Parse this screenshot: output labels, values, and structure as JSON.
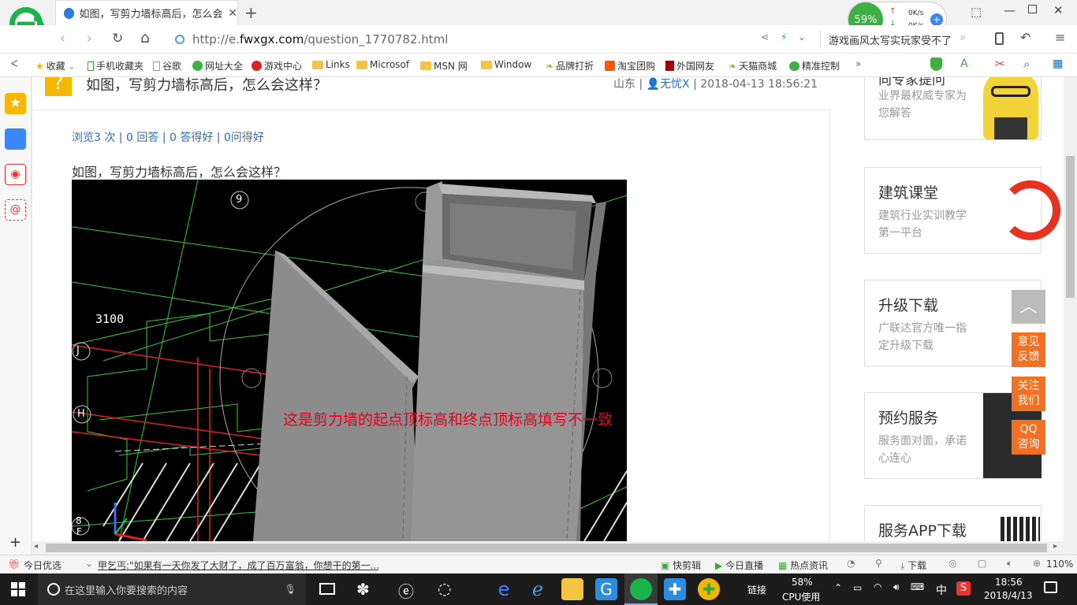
{
  "browser": {
    "tab_title": "如图，写剪力墙标高后，怎么会这样？",
    "url_prefix": "http://e.",
    "url_domain": "fwxgx.com",
    "url_path": "/question_1770782.html",
    "search_text": "游戏画风太写实玩家受不了",
    "speed_percent": "59%",
    "speed_up": "0K/s",
    "speed_down": "0K/s",
    "zoom": "110%"
  },
  "favorites": [
    "收藏",
    "手机收藏夹",
    "谷歌",
    "网址大全",
    "游戏中心",
    "Links",
    "Microsof",
    "MSN 网",
    "Window",
    "品牌打折",
    "淘宝团购",
    "外国网友",
    "天猫商城",
    "精准控制"
  ],
  "question": {
    "title": "如图，写剪力墙标高后，怎么会这样？",
    "meta_location": "山东",
    "meta_user": "无忧X",
    "meta_time": "2018-04-13 18:56:21",
    "stats": {
      "views": "浏览3 次",
      "answers": "0 回答",
      "good_answers": "0 答得好",
      "good_questions": "0问得好"
    },
    "body": "如图，写剪力墙标高后，怎么会这样？",
    "image_dimension": "3100",
    "image_annotation": "这是剪力墙的起点顶标高和终点顶标高填写不一致",
    "axis_labels": [
      "9",
      "J",
      "H",
      "8",
      "F"
    ]
  },
  "sidebar_cards": [
    {
      "title": "向专家提问",
      "sub": "业界最权威专家为您解答"
    },
    {
      "title": "建筑课堂",
      "sub": "建筑行业实训教学第一平台"
    },
    {
      "title": "升级下载",
      "sub": "广联达官方唯一指定升级下载"
    },
    {
      "title": "预约服务",
      "sub": "服务面对面，承诺心连心"
    },
    {
      "title": "服务APP下载",
      "sub": ""
    }
  ],
  "float_buttons": [
    "意见反馈",
    "关注我们",
    "QQ咨询"
  ],
  "statusbar": {
    "today": "今日优选",
    "news": "甲乞丐:\"如果有一天你发了大财了，成了百万富翁，你想干的第一...",
    "items": [
      "快剪辑",
      "今日直播",
      "热点资讯",
      "下载"
    ]
  },
  "taskbar": {
    "search_placeholder": "在这里输入你要搜索的内容",
    "network": "链接",
    "cpu_percent": "58%",
    "cpu_label": "CPU使用",
    "ime": "中",
    "time": "18:56",
    "date": "2018/4/13"
  },
  "colors": {
    "accent": "#3a86ff",
    "orange": "#f36f21",
    "link": "#2a6ebb",
    "annotation": "#e8001c"
  }
}
